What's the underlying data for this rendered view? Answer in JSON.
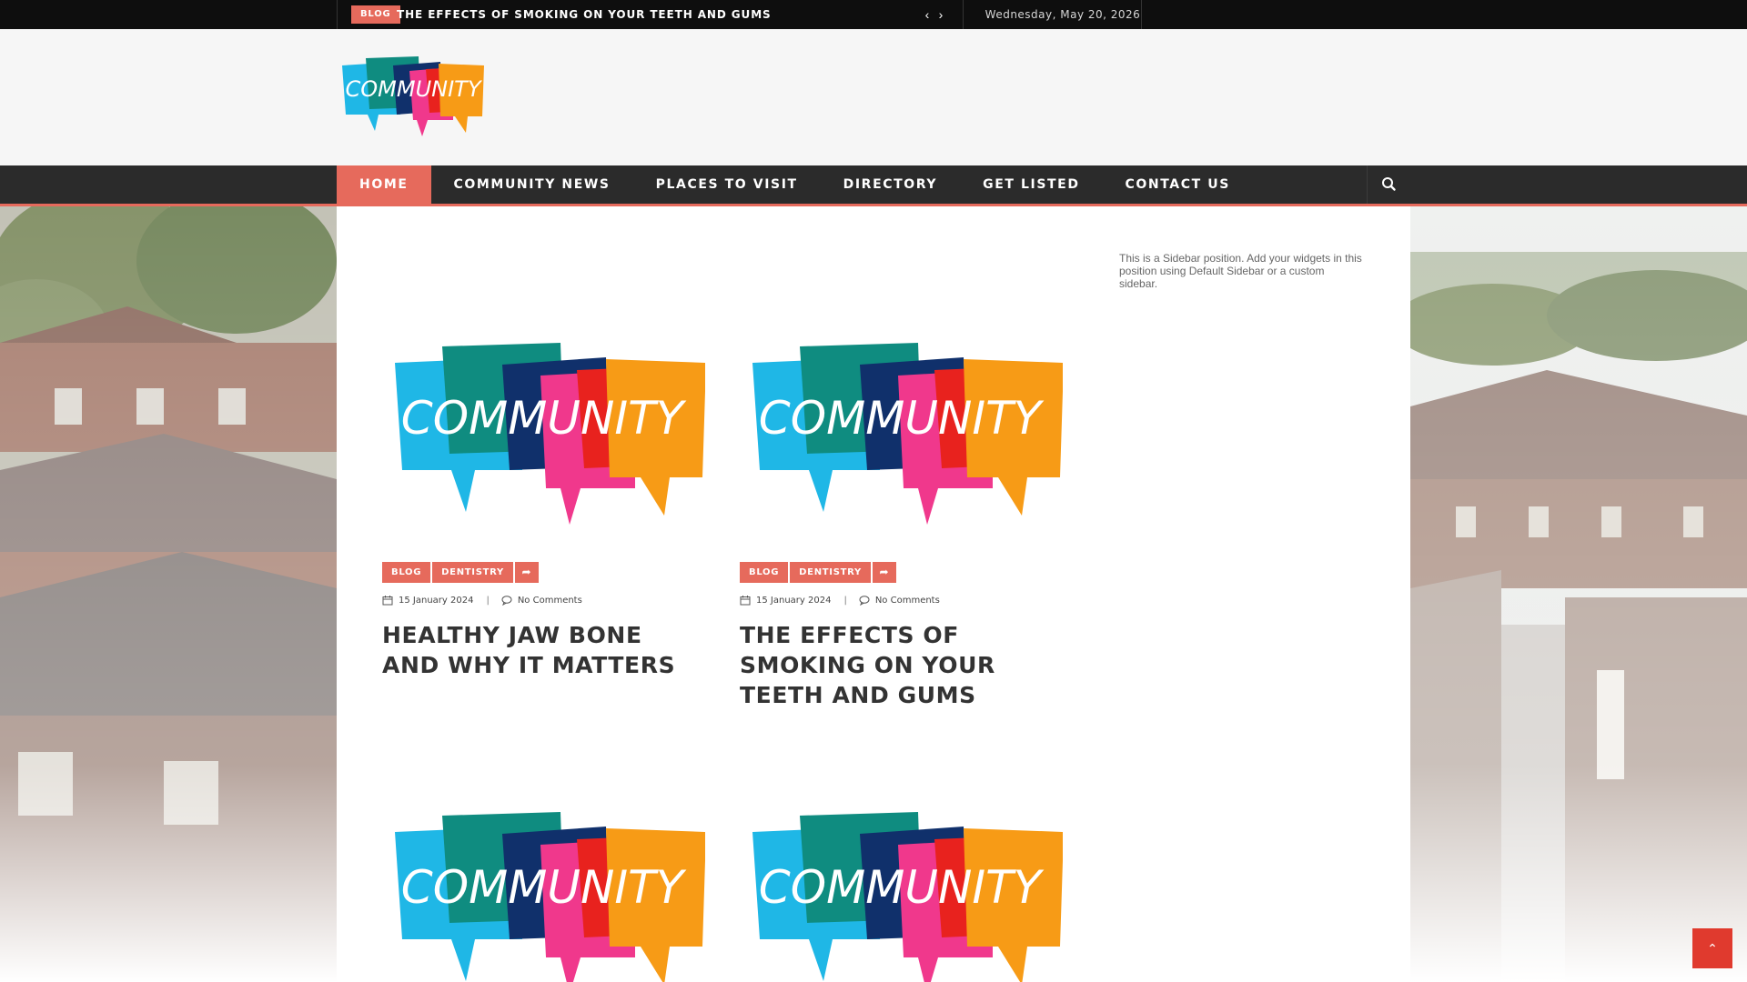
{
  "topbar": {
    "ticker": {
      "badge": "BLOG",
      "title": "THE EFFECTS OF SMOKING ON YOUR TEETH AND GUMS",
      "prev_glyph": "‹",
      "next_glyph": "›"
    },
    "date": "Wednesday, May 20, 2026"
  },
  "header": {
    "logo_text": "COMMUNITY"
  },
  "nav": {
    "items": [
      {
        "label": "HOME",
        "active": true
      },
      {
        "label": "COMMUNITY NEWS",
        "active": false
      },
      {
        "label": "PLACES TO VISIT",
        "active": false
      },
      {
        "label": "DIRECTORY",
        "active": false
      },
      {
        "label": "GET LISTED",
        "active": false
      },
      {
        "label": "CONTACT US",
        "active": false
      }
    ],
    "search_icon": "search-icon"
  },
  "posts": [
    {
      "image_text": "COMMUNITY",
      "tags": [
        "BLOG",
        "DENTISTRY"
      ],
      "date": "15 January 2024",
      "comments": "No Comments",
      "title": "HEALTHY JAW BONE AND WHY IT MATTERS"
    },
    {
      "image_text": "COMMUNITY",
      "tags": [
        "BLOG",
        "DENTISTRY"
      ],
      "date": "15 January 2024",
      "comments": "No Comments",
      "title": "THE EFFECTS OF SMOKING ON YOUR TEETH AND GUMS"
    },
    {
      "image_text": "COMMUNITY"
    },
    {
      "image_text": "COMMUNITY"
    }
  ],
  "meta_separator": "|",
  "share_glyph": "➦",
  "sidebar": {
    "text": "This is a Sidebar position. Add your widgets in this position using Default Sidebar or a custom sidebar."
  },
  "back_to_top": {
    "glyph": "⌃",
    "icon": "chevron-up-icon"
  },
  "colors": {
    "accent": "#e66a5c",
    "topbar": "#0e0e0e",
    "nav": "#2b2b2b",
    "logo_cyan": "#1fb7e6",
    "logo_teal": "#0f8c80",
    "logo_navy": "#10306b",
    "logo_pink": "#f0388c",
    "logo_red": "#e8221e",
    "logo_orange": "#f79b16"
  }
}
